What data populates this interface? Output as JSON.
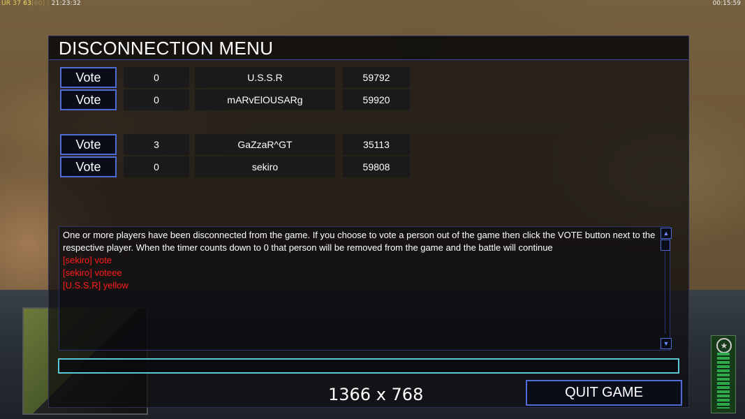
{
  "hud": {
    "top_left": {
      "prefix": "UR 37",
      "fps": "63",
      "fps_max": "[60]",
      "clock": "21:23:32"
    },
    "top_right": "00:15:59"
  },
  "dialog": {
    "title": "DISCONNECTION MENU",
    "vote_label": "Vote",
    "players": [
      {
        "votes": "0",
        "name": "U.S.S.R",
        "ping": "59792"
      },
      {
        "votes": "0",
        "name": "mARvElOUSARg",
        "ping": "59920"
      },
      {
        "votes": "3",
        "name": "GaZzaR^GT",
        "ping": "35113"
      },
      {
        "votes": "0",
        "name": "sekiro",
        "ping": "59808"
      }
    ],
    "chat": {
      "system_message": "One or more players have been disconnected from the game. If you choose to vote a person out of the game then click the VOTE button next to the respective player. When the timer counts down to 0 that person will be removed from the game and the battle will continue",
      "messages": [
        "[sekiro] vote",
        "[sekiro] voteee",
        "[U.S.S.R] yellow"
      ]
    },
    "chat_input_value": "",
    "quit_label": "QUIT GAME"
  },
  "overlay_resolution": "1366 x 768",
  "colors": {
    "accent_border": "#4f6bd8",
    "chat_message": "#ff1c1c",
    "input_border": "#58c8d8"
  }
}
